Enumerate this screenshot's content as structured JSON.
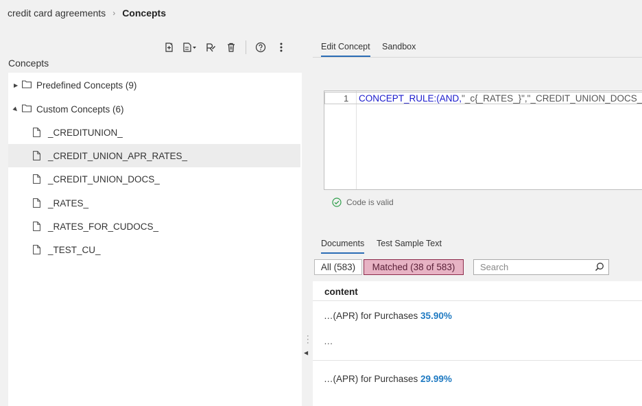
{
  "breadcrumb": {
    "parent": "credit card agreements",
    "separator": "›",
    "current": "Concepts"
  },
  "toolbar": {
    "icons": [
      "new-concept-icon",
      "import-icon",
      "rename-icon",
      "delete-icon",
      "help-icon",
      "more-options-icon"
    ]
  },
  "left_panel": {
    "title": "Concepts",
    "groups": [
      {
        "label": "Predefined Concepts (9)",
        "expanded": false
      },
      {
        "label": "Custom Concepts (6)",
        "expanded": true
      }
    ],
    "items": [
      {
        "label": "_CREDITUNION_",
        "selected": false
      },
      {
        "label": "_CREDIT_UNION_APR_RATES_",
        "selected": true
      },
      {
        "label": "_CREDIT_UNION_DOCS_",
        "selected": false
      },
      {
        "label": "_RATES_",
        "selected": false
      },
      {
        "label": "_RATES_FOR_CUDOCS_",
        "selected": false
      },
      {
        "label": "_TEST_CU_",
        "selected": false
      }
    ]
  },
  "right_panel": {
    "tabs": [
      "Edit Concept",
      "Sandbox"
    ],
    "active_tab": "Edit Concept",
    "editor": {
      "line_number": "1",
      "code_keyword": "CONCEPT_RULE:(AND,",
      "code_rest": "\"_c{_RATES_}\",\"_CREDIT_UNION_DOCS_\")"
    },
    "validation": "Code is valid",
    "doc_tabs": [
      "Documents",
      "Test Sample Text"
    ],
    "active_doc_tab": "Documents",
    "filters": {
      "all": "All (583)",
      "matched": "Matched (38 of 583)"
    },
    "search": {
      "placeholder": "Search"
    },
    "results": {
      "column_header": "content",
      "rows": [
        {
          "prefix": "…(APR) for Purchases ",
          "highlight": "35.90%",
          "continuation": "…"
        },
        {
          "prefix": "…(APR) for Purchases ",
          "highlight": "29.99%"
        }
      ]
    }
  },
  "colors": {
    "accent": "#2a6cb5",
    "matched_fill": "#e7b3c4",
    "matched_border": "#8c2a4a",
    "highlight_text": "#1f7ac2",
    "keyword": "#1a1acc",
    "valid_green": "#2e9e4a"
  }
}
